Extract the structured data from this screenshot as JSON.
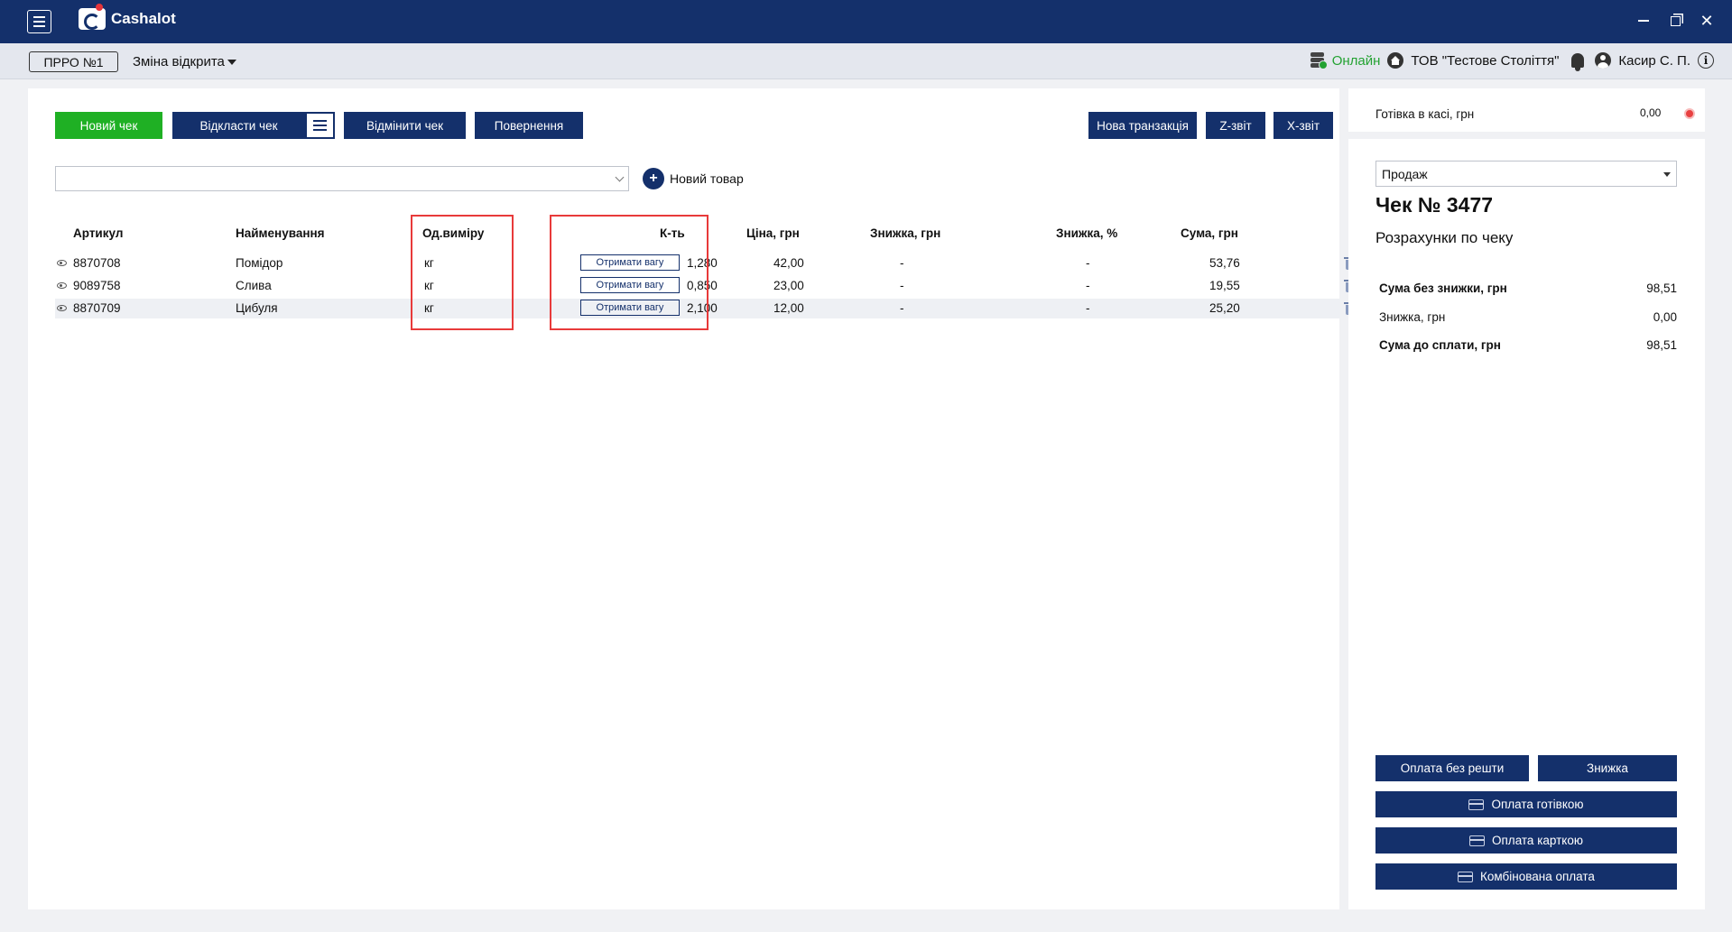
{
  "app": {
    "name": "Cashalot"
  },
  "statusbar": {
    "prro": "ПРРО №1",
    "shift": "Зміна відкрита",
    "online": "Онлайн",
    "company": "ТОВ \"Тестове Століття\"",
    "cashier": "Касир С. П."
  },
  "toolbar": {
    "new_receipt": "Новий чек",
    "postpone": "Відкласти чек",
    "cancel": "Відмінити чек",
    "return": "Повернення",
    "new_transaction": "Нова транзакція",
    "z_report": "Z-звіт",
    "x_report": "X-звіт"
  },
  "search": {
    "placeholder": ""
  },
  "new_item": "Новий товар",
  "table": {
    "headers": {
      "article": "Артикул",
      "name": "Найменування",
      "unit": "Од.виміру",
      "qty": "К-ть",
      "price": "Ціна, грн",
      "discount_uah": "Знижка, грн",
      "discount_pct": "Знижка, %",
      "sum": "Сума, грн"
    },
    "weigh_label": "Отримати вагу",
    "rows": [
      {
        "article": "8870708",
        "name": "Помідор",
        "unit": "кг",
        "qty": "1,280",
        "price": "42,00",
        "discount_uah": "-",
        "discount_pct": "-",
        "sum": "53,76"
      },
      {
        "article": "9089758",
        "name": "Слива",
        "unit": "кг",
        "qty": "0,850",
        "price": "23,00",
        "discount_uah": "-",
        "discount_pct": "-",
        "sum": "19,55"
      },
      {
        "article": "8870709",
        "name": "Цибуля",
        "unit": "кг",
        "qty": "2,100",
        "price": "12,00",
        "discount_uah": "-",
        "discount_pct": "-",
        "sum": "25,20"
      }
    ]
  },
  "cash": {
    "label": "Готівка в касі, грн",
    "value": "0,00"
  },
  "receipt": {
    "type": "Продаж",
    "title": "Чек № 3477",
    "subtitle": "Розрахунки по чеку",
    "sum_no_discount_label": "Сума без знижки, грн",
    "sum_no_discount": "98,51",
    "discount_label": "Знижка, грн",
    "discount": "0,00",
    "to_pay_label": "Сума до сплати, грн",
    "to_pay": "98,51"
  },
  "payment": {
    "no_change": "Оплата без решти",
    "discount": "Знижка",
    "cash": "Оплата готівкою",
    "card": "Оплата карткою",
    "combined": "Комбінована оплата"
  },
  "colors": {
    "brand": "#14306b",
    "accent_green": "#1fb024",
    "online": "#23a232",
    "highlight": "#e83a3a"
  }
}
